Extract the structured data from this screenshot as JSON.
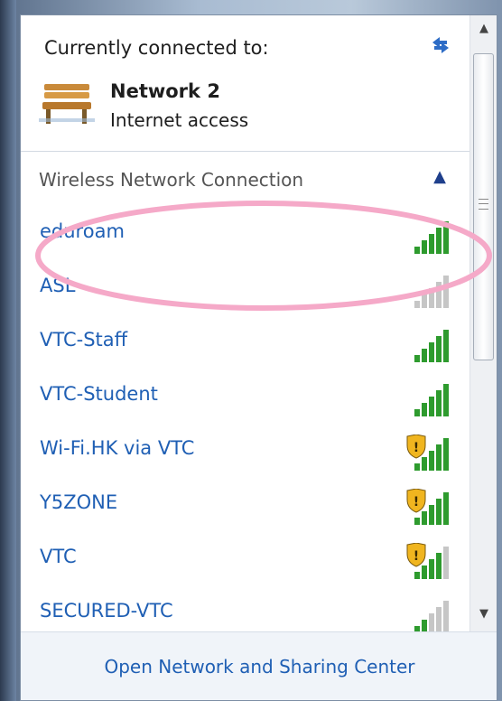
{
  "connection": {
    "heading": "Currently connected to:",
    "network_name": "Network  2",
    "network_status": "Internet access",
    "network_icon": "bench-icon",
    "refresh_icon": "refresh-arrows-icon"
  },
  "wireless": {
    "section_title": "Wireless Network Connection",
    "collapse_icon": "chevron-up-icon",
    "networks": [
      {
        "name": "eduroam",
        "signal_level": 5,
        "secured_warning": false,
        "signal_color": "#2e9b2e"
      },
      {
        "name": "ASL",
        "signal_level": 0,
        "secured_warning": false,
        "signal_color": "#b3b3b3"
      },
      {
        "name": "VTC-Staff",
        "signal_level": 5,
        "secured_warning": false,
        "signal_color": "#2e9b2e"
      },
      {
        "name": "VTC-Student",
        "signal_level": 5,
        "secured_warning": false,
        "signal_color": "#2e9b2e"
      },
      {
        "name": "Wi-Fi.HK via VTC",
        "signal_level": 5,
        "secured_warning": true,
        "signal_color": "#2e9b2e"
      },
      {
        "name": "Y5ZONE",
        "signal_level": 5,
        "secured_warning": true,
        "signal_color": "#2e9b2e"
      },
      {
        "name": "VTC",
        "signal_level": 4,
        "secured_warning": true,
        "signal_color": "#2e9b2e"
      },
      {
        "name": "SECURED-VTC",
        "signal_level": 2,
        "secured_warning": false,
        "signal_color": "#2e9b2e"
      }
    ]
  },
  "footer": {
    "link_label": "Open Network and Sharing Center"
  },
  "colors": {
    "link": "#1f5fb4",
    "highlight": "#f5a9c8"
  }
}
